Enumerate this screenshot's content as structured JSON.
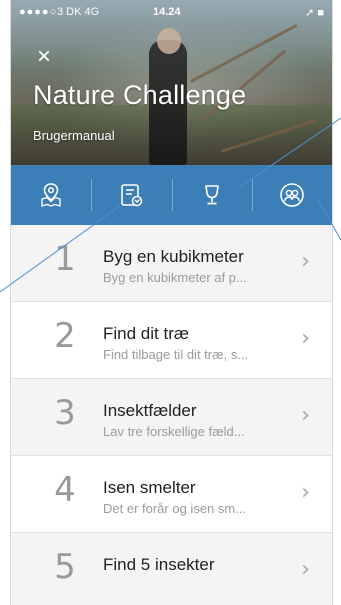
{
  "status_bar": {
    "signal": "●●●●○",
    "carrier": "3 DK  4G",
    "time": "14.24",
    "right": "➚ ■"
  },
  "header": {
    "close_icon": "×",
    "title": "Nature Challenge",
    "subtitle": "Brugermanual"
  },
  "tabs": [
    {
      "name": "map",
      "icon": "map-pin-icon"
    },
    {
      "name": "challenges",
      "icon": "list-sync-icon"
    },
    {
      "name": "trophy",
      "icon": "trophy-icon"
    },
    {
      "name": "profile",
      "icon": "people-icon"
    }
  ],
  "challenges": [
    {
      "number": "1",
      "title": "Byg en kubikmeter",
      "subtitle": "Byg en kubikmeter af p...",
      "chevron": "›"
    },
    {
      "number": "2",
      "title": "Find dit træ",
      "subtitle": "Find tilbage til dit træ, s...",
      "chevron": "›"
    },
    {
      "number": "3",
      "title": "Insektfælder",
      "subtitle": "Lav tre forskellige fæld...",
      "chevron": "›"
    },
    {
      "number": "4",
      "title": "Isen smelter",
      "subtitle": "Det er forår og isen sm...",
      "chevron": "›"
    },
    {
      "number": "5",
      "title": "Find 5 insekter",
      "subtitle": "",
      "chevron": "›"
    }
  ],
  "colors": {
    "tabbar": "#3c7fb6",
    "annotation_line": "#4a8fd1"
  }
}
